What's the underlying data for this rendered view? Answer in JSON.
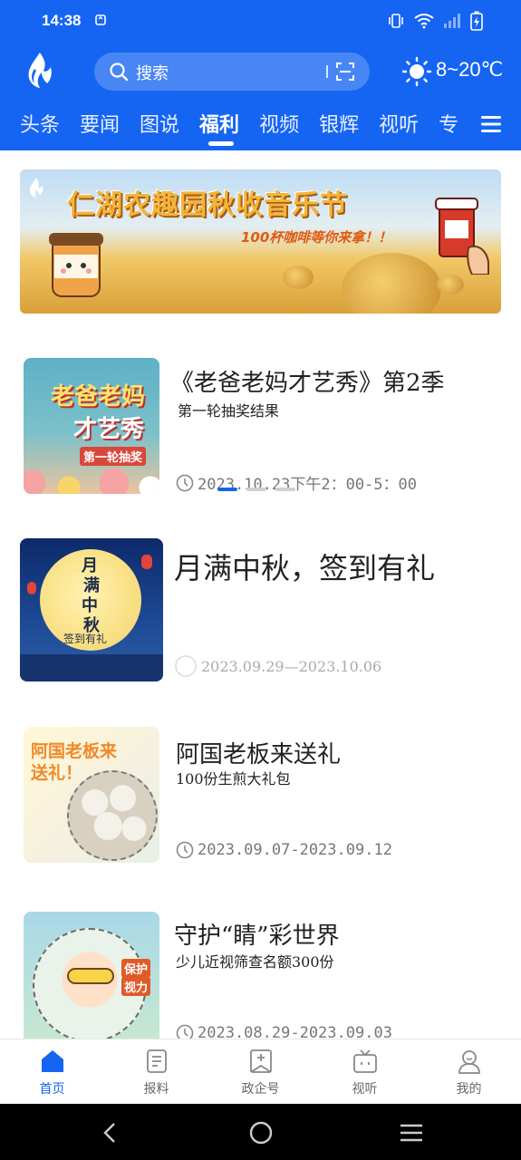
{
  "status_bar": {
    "time": "14:38"
  },
  "header": {
    "search_placeholder": "搜索",
    "weather": "8~20℃"
  },
  "tabs": [
    {
      "label": "头条"
    },
    {
      "label": "要闻"
    },
    {
      "label": "图说"
    },
    {
      "label": "福利",
      "active": true
    },
    {
      "label": "视频"
    },
    {
      "label": "银辉"
    },
    {
      "label": "视听"
    },
    {
      "label": "专"
    }
  ],
  "banner": {
    "title": "仁湖农趣园秋收音乐节",
    "subtitle": "100杯咖啡等你来拿！！"
  },
  "items": [
    {
      "title": "《老爸老妈才艺秀》第2季",
      "subtitle": "第一轮抽奖结果",
      "date": "2023.10.23下午2：00-5：00",
      "thumb_lines": [
        "老爸老妈",
        "才艺秀",
        "第一轮抽奖"
      ]
    },
    {
      "title": "月满中秋，签到有礼",
      "subtitle": "",
      "date": "2023.09.29—2023.10.06",
      "thumb_lines": [
        "月",
        "满",
        "中",
        "秋",
        "签到有礼"
      ]
    },
    {
      "title": "阿国老板来送礼",
      "subtitle": "100份生煎大礼包",
      "date": "2023.09.07-2023.09.12",
      "thumb_lines": [
        "阿国老板来",
        "送礼！"
      ]
    },
    {
      "title": "守护“睛”彩世界",
      "subtitle": "少儿近视筛查名额300份",
      "date": "2023.08.29-2023.09.03",
      "thumb_lines": [
        "保护",
        "视力"
      ]
    }
  ],
  "bottom_nav": [
    {
      "label": "首页",
      "icon": "home-icon",
      "active": true
    },
    {
      "label": "报料",
      "icon": "report-icon"
    },
    {
      "label": "政企号",
      "icon": "gov-account-icon"
    },
    {
      "label": "视听",
      "icon": "tv-icon"
    },
    {
      "label": "我的",
      "icon": "profile-icon"
    }
  ],
  "colors": {
    "brand": "#1565f2",
    "text": "#222222",
    "muted": "#777777"
  }
}
